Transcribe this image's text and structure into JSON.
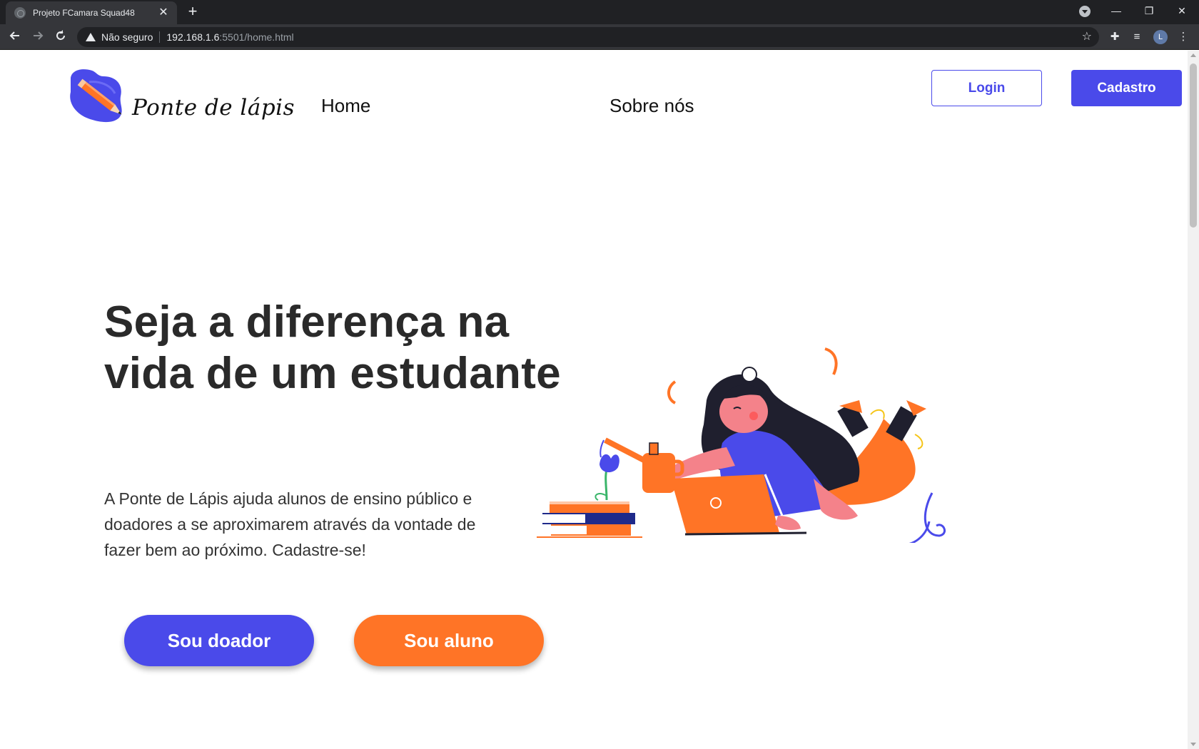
{
  "browser": {
    "tab_title": "Projeto FCamara Squad48",
    "tab_close": "✕",
    "new_tab": "+",
    "not_secure": "Não seguro",
    "url_host": "192.168.1.6",
    "url_rest": ":5501/home.html",
    "profile_initial": "L",
    "window_controls": {
      "minimize": "—",
      "restore": "❐",
      "close": "✕"
    }
  },
  "header": {
    "logo_text": "Ponte de lápis",
    "nav": {
      "home": "Home",
      "about": "Sobre nós"
    },
    "login_label": "Login",
    "signup_label": "Cadastro"
  },
  "hero": {
    "title": "Seja a diferença na vida de um estudante",
    "description": "A Ponte de Lápis ajuda alunos de ensino público e doadores a se aproximarem através da vontade de fazer bem ao próximo. Cadastre-se!",
    "donor_button": "Sou doador",
    "student_button": "Sou aluno"
  },
  "colors": {
    "primary": "#4a4aea",
    "accent": "#ff7426",
    "text": "#2a2a2a",
    "skin": "#f4828a",
    "dark": "#1f1f2e"
  }
}
